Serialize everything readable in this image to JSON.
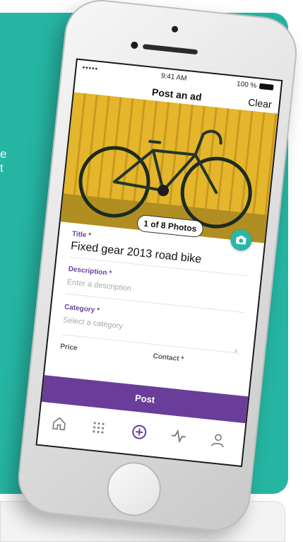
{
  "background_card": {
    "fragment_1": "e",
    "fragment_2": "t"
  },
  "status_bar": {
    "carrier": "•••••",
    "time": "9:41 AM",
    "battery": "100 %"
  },
  "nav": {
    "title": "Post an ad",
    "clear_label": "Clear"
  },
  "photo": {
    "counter": "1 of 8 Photos"
  },
  "form": {
    "title_label": "Title *",
    "title_value": "Fixed gear 2013 road bike",
    "description_label": "Description *",
    "description_placeholder": "Enter a description",
    "category_label": "Category *",
    "category_placeholder": "Select a category",
    "price_label": "Price",
    "contact_label": "Contact *"
  },
  "post_button_label": "Post",
  "tabbar": {
    "items": [
      {
        "icon": "home-icon"
      },
      {
        "icon": "grid-icon"
      },
      {
        "icon": "add-circle-icon",
        "active": true
      },
      {
        "icon": "activity-icon"
      },
      {
        "icon": "profile-icon"
      }
    ]
  },
  "colors": {
    "teal": "#26b5a3",
    "purple": "#6a3d9a",
    "label_purple": "#6b3fa0",
    "photo_yellow": "#e5b52b"
  }
}
